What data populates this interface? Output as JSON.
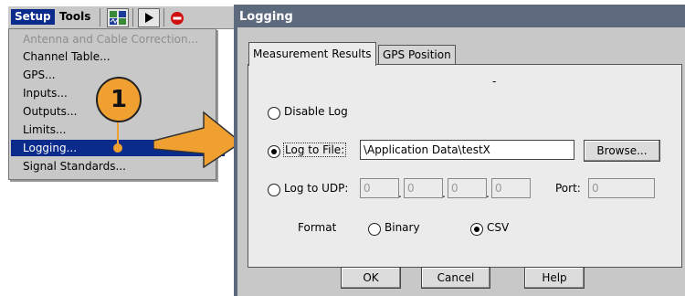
{
  "menubar": {
    "setup_label": "Setup",
    "tools_label": "Tools"
  },
  "setup_menu": {
    "items": [
      {
        "label": "Antenna and Cable Correction...",
        "state": "disabled"
      },
      {
        "label": "Channel Table...",
        "state": "normal"
      },
      {
        "label": "GPS...",
        "state": "normal"
      },
      {
        "label": "Inputs...",
        "state": "normal"
      },
      {
        "label": "Outputs...",
        "state": "normal"
      },
      {
        "label": "Limits...",
        "state": "normal"
      },
      {
        "label": "Logging...",
        "state": "selected"
      },
      {
        "label": "Signal Standards...",
        "state": "normal"
      }
    ]
  },
  "callout": {
    "number": "1"
  },
  "dialog": {
    "title": "Logging",
    "tabs": [
      {
        "label": "Measurement Results",
        "active": true
      },
      {
        "label": "GPS Position",
        "active": false
      }
    ],
    "dash": "-",
    "disable_log_label": "Disable Log",
    "log_to_file_label": "Log to File:",
    "file_path": "\\Application Data\\testX",
    "browse_label": "Browse...",
    "log_to_udp_label": "Log to UDP:",
    "udp_octets": [
      "0",
      "0",
      "0",
      "0"
    ],
    "port_label": "Port:",
    "port_value": "0",
    "format_label": "Format",
    "binary_label": "Binary",
    "csv_label": "CSV",
    "selected_mode": "log-to-file",
    "selected_format": "csv",
    "ok_label": "OK",
    "cancel_label": "Cancel",
    "help_label": "Help"
  },
  "colors": {
    "menu_highlight": "#0a2a8c",
    "callout": "#f0a030",
    "dialog_frame": "#5d6a7e",
    "panel": "#ebebeb"
  }
}
